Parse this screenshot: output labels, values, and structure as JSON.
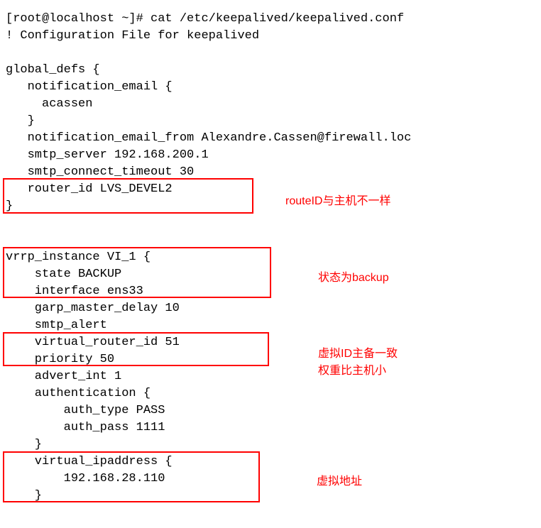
{
  "lines": {
    "l1": "[root@localhost ~]# cat /etc/keepalived/keepalived.conf",
    "l2": "! Configuration File for keepalived",
    "l3": "",
    "l4": "global_defs {",
    "l5": "   notification_email {",
    "l6": "     acassen",
    "l7": "   }",
    "l8": "   notification_email_from Alexandre.Cassen@firewall.loc",
    "l9": "   smtp_server 192.168.200.1",
    "l10": "   smtp_connect_timeout 30",
    "l11": "   router_id LVS_DEVEL2",
    "l12": "}",
    "l13": "",
    "l14": "",
    "l15": "vrrp_instance VI_1 {",
    "l16": "    state BACKUP",
    "l17": "    interface ens33",
    "l18": "    garp_master_delay 10",
    "l19": "    smtp_alert",
    "l20": "    virtual_router_id 51",
    "l21": "    priority 50",
    "l22": "    advert_int 1",
    "l23": "    authentication {",
    "l24": "        auth_type PASS",
    "l25": "        auth_pass 1111",
    "l26": "    }",
    "l27": "    virtual_ipaddress {",
    "l28": "        192.168.28.110",
    "l29": "    }"
  },
  "annotations": {
    "a1": "routeID与主机不一样",
    "a2": "状态为backup",
    "a3_line1": "虚拟ID主备一致",
    "a3_line2": "权重比主机小",
    "a4": "虚拟地址"
  }
}
